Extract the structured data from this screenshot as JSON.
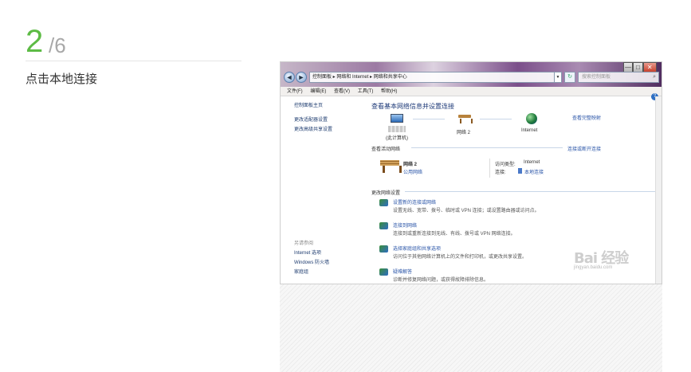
{
  "step": {
    "current": "2",
    "total": "/6",
    "instruction": "点击本地连接"
  },
  "window": {
    "nav": {
      "back": "◄",
      "forward": "►"
    },
    "address": "控制面板 ▸ 网络和 Internet ▸ 网络和共享中心",
    "search_placeholder": "搜索控制面板",
    "controls": {
      "minimize": "—",
      "maximize": "□",
      "close": "✕"
    }
  },
  "menubar": [
    "文件(F)",
    "编辑(E)",
    "查看(V)",
    "工具(T)",
    "帮助(H)"
  ],
  "sidebar": {
    "links": [
      "控制面板主页",
      "更改适配器设置",
      "更改高级共享设置"
    ],
    "see_also_title": "另请参阅",
    "see_also": [
      "Internet 选项",
      "Windows 防火墙",
      "家庭组"
    ]
  },
  "main": {
    "title": "查看基本网络信息并设置连接",
    "map_link": "查看完整映射",
    "map_nodes": {
      "computer": "(此计算机)",
      "network": "网络  2",
      "internet": "Internet"
    },
    "active_head": "查看活动网络",
    "connect_link": "连接或断开连接",
    "network_name": "网络  2",
    "network_type": "公用网络",
    "access_type_label": "访问类型:",
    "access_type_value": "Internet",
    "connection_label": "连接:",
    "connection_value": "本地连接",
    "change_head": "更改网络设置",
    "tasks": [
      {
        "title": "设置新的连接或网络",
        "desc": "设置无线、宽带、拨号、临时或 VPN 连接；或设置路由器或访问点。"
      },
      {
        "title": "连接到网络",
        "desc": "连接到或重新连接到无线、有线、拨号或 VPN 网络连接。"
      },
      {
        "title": "选择家庭组和共享选项",
        "desc": "访问位于其他网络计算机上的文件和打印机，或更改共享设置。"
      },
      {
        "title": "疑难解答",
        "desc": "诊断并修复网络问题，或获得故障排除信息。"
      }
    ]
  },
  "watermark": {
    "logo": "Bai 经验",
    "url": "jingyan.baidu.com"
  }
}
